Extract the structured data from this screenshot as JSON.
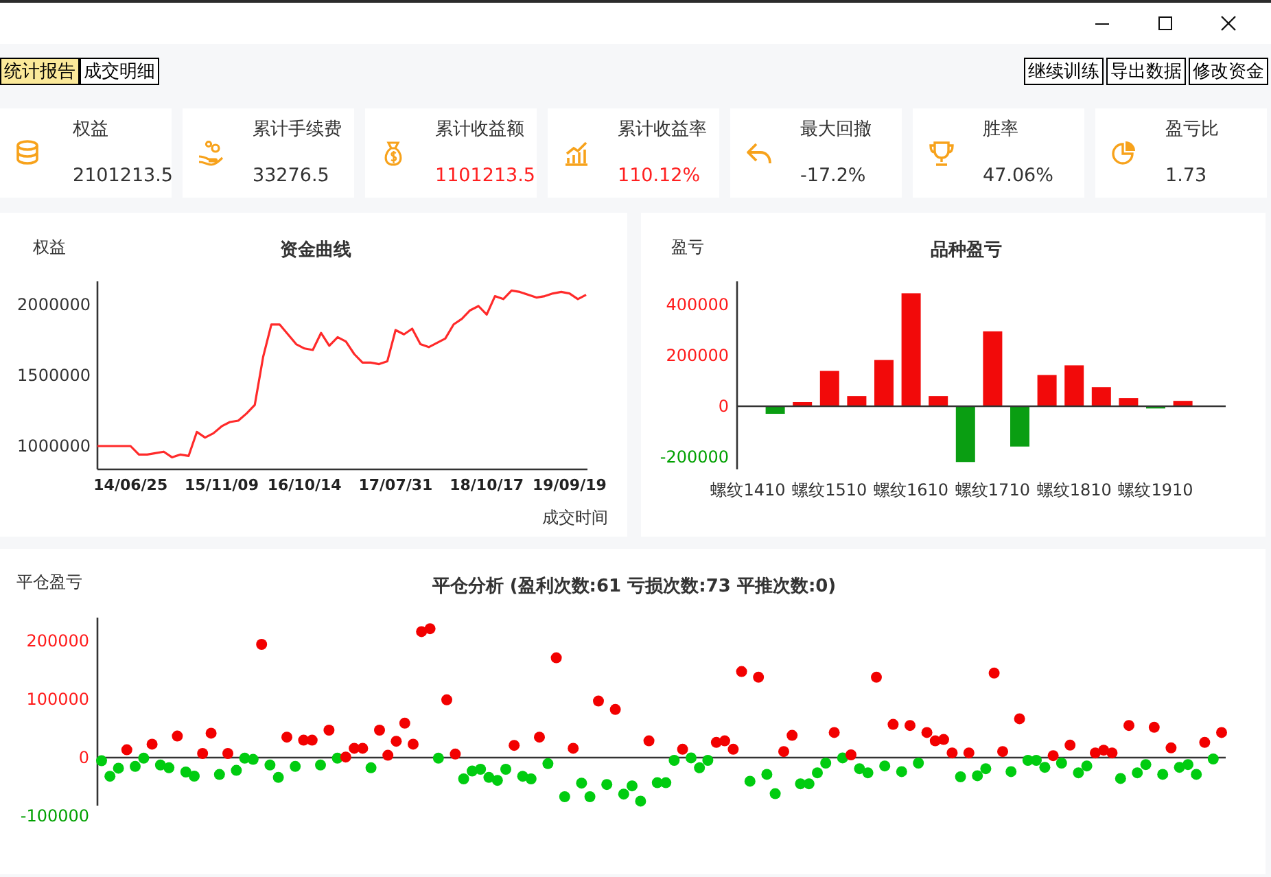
{
  "toolbar": {
    "tabs": [
      {
        "label": "统计报告",
        "selected": true
      },
      {
        "label": "成交明细",
        "selected": false
      }
    ],
    "actions": [
      "继续训练",
      "导出数据",
      "修改资金"
    ]
  },
  "stats": [
    {
      "label": "权益",
      "value": "2101213.5",
      "color": "#333333"
    },
    {
      "label": "累计手续费",
      "value": "33276.5",
      "color": "#333333"
    },
    {
      "label": "累计收益额",
      "value": "1101213.5",
      "color": "#ff2020"
    },
    {
      "label": "累计收益率",
      "value": "110.12%",
      "color": "#ff2020"
    },
    {
      "label": "最大回撤",
      "value": "-17.2%",
      "color": "#333333"
    },
    {
      "label": "胜率",
      "value": "47.06%",
      "color": "#333333"
    },
    {
      "label": "盈亏比",
      "value": "1.73",
      "color": "#333333"
    }
  ],
  "equity_panel": {
    "chart_data": {
      "type": "line",
      "title": "资金曲线",
      "ylabel": "权益",
      "xlabel": "成交时间",
      "categories": [
        null,
        null,
        null,
        null,
        "14/06/25",
        null,
        null,
        null,
        null,
        null,
        null,
        null,
        null,
        null,
        null,
        "15/11/09",
        null,
        null,
        null,
        null,
        null,
        null,
        null,
        null,
        null,
        "16/10/14",
        null,
        null,
        null,
        null,
        null,
        null,
        null,
        null,
        null,
        null,
        "17/07/31",
        null,
        null,
        null,
        null,
        null,
        null,
        null,
        null,
        null,
        null,
        "18/10/17",
        null,
        null,
        null,
        null,
        null,
        null,
        null,
        null,
        null,
        "19/09/19",
        null,
        null
      ],
      "series": [
        {
          "color": "#ff2a2a",
          "values": [
            1000000,
            1000000,
            1000000,
            1000000,
            1000000,
            940000,
            940000,
            950000,
            960000,
            920000,
            940000,
            930000,
            1100000,
            1060000,
            1090000,
            1140000,
            1170000,
            1180000,
            1230000,
            1290000,
            1630000,
            1860000,
            1860000,
            1790000,
            1720000,
            1690000,
            1680000,
            1800000,
            1710000,
            1770000,
            1740000,
            1650000,
            1590000,
            1590000,
            1580000,
            1600000,
            1820000,
            1790000,
            1830000,
            1720000,
            1700000,
            1730000,
            1760000,
            1860000,
            1900000,
            1960000,
            1990000,
            1930000,
            2060000,
            2040000,
            2100000,
            2090000,
            2070000,
            2050000,
            2060000,
            2080000,
            2090000,
            2080000,
            2040000,
            2070000
          ]
        }
      ],
      "ylim": [
        835000,
        2165000
      ],
      "yticks": [
        1000000,
        1500000,
        2000000
      ]
    }
  },
  "variety_panel": {
    "chart_data": {
      "type": "bar",
      "title": "品种盈亏",
      "ylabel": "盈亏",
      "categories": [
        "螺纹1410",
        null,
        null,
        "螺纹1510",
        null,
        null,
        "螺纹1610",
        null,
        null,
        "螺纹1710",
        null,
        null,
        "螺纹1810",
        null,
        null,
        "螺纹1910",
        null
      ],
      "values": [
        0,
        -30000,
        16000,
        139000,
        40000,
        182000,
        445000,
        40000,
        -220000,
        295000,
        -159000,
        123000,
        161000,
        75000,
        32000,
        -9000,
        21000
      ],
      "ylim": [
        -249000,
        492000
      ],
      "yticks": [
        -200000,
        0,
        200000,
        400000
      ]
    }
  },
  "close_panel": {
    "chart_data": {
      "type": "scatter",
      "title": "平仓分析 (盈利次数:61 亏损次数:73 平推次数:0)",
      "ylabel": "平仓盈亏",
      "values": [
        -5500,
        -32000,
        -18000,
        13500,
        -15000,
        -1000,
        23000,
        -12700,
        -17500,
        37000,
        -24600,
        -31700,
        7000,
        42000,
        -29000,
        7000,
        -22000,
        -1000,
        -3000,
        194000,
        -12700,
        -34000,
        35000,
        -15000,
        30000,
        30000,
        -12700,
        47000,
        -1000,
        1000,
        16000,
        16000,
        -17500,
        47000,
        4000,
        28000,
        59000,
        23000,
        216000,
        221000,
        -1000,
        99000,
        6000,
        -36500,
        -23000,
        -20000,
        -34000,
        -39000,
        -20000,
        21000,
        -32000,
        -36500,
        35000,
        -10300,
        171000,
        -67000,
        16000,
        -43700,
        -67000,
        97000,
        -46000,
        82500,
        -62700,
        -48400,
        -74600,
        28600,
        -43000,
        -43000,
        -4800,
        14300,
        -500,
        -17500,
        -4800,
        26000,
        28600,
        14300,
        147600,
        -40500,
        138000,
        -28600,
        -62000,
        10300,
        38000,
        -45000,
        -45000,
        -26000,
        -9500,
        43000,
        -500,
        4700,
        -19000,
        -26000,
        138000,
        -14300,
        57000,
        -24000,
        55000,
        -9500,
        43000,
        28600,
        31000,
        8000,
        -33000,
        8000,
        -31000,
        -19000,
        145000,
        10300,
        -24000,
        66700,
        -4800,
        -4800,
        -16700,
        3200,
        -9500,
        21400,
        -26000,
        -14300,
        8000,
        12700,
        8000,
        -35700,
        55000,
        -26000,
        -12000,
        52000,
        -28600,
        16700,
        -16700,
        -12000,
        -28600,
        26000,
        -2400,
        43000
      ],
      "ylim": [
        -100000,
        240000
      ],
      "yticks": [
        -100000,
        0,
        100000,
        200000
      ]
    }
  }
}
